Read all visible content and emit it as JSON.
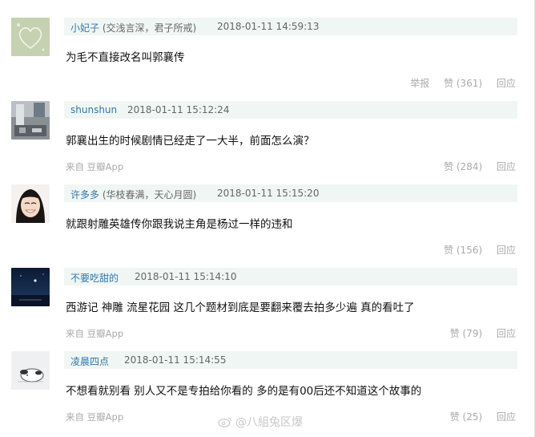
{
  "comments": [
    {
      "author": "小妃子",
      "signature": "(交浅言深，君子所戒)",
      "time": "2018-01-11 14:59:13",
      "content": "为毛不直接改名叫郭襄传",
      "source": "",
      "report": "举报",
      "like": "赞 (361)",
      "reply": "回应",
      "avatar_icon": "heart-drawing"
    },
    {
      "author": "shunshun",
      "signature": "",
      "time": "2018-01-11 15:12:24",
      "content": "郭襄出生的时候剧情已经走了一大半，前面怎么演？",
      "source": "来自 豆瓣App",
      "report": "",
      "like": "赞 (284)",
      "reply": "回应",
      "avatar_icon": "room-photo"
    },
    {
      "author": "许多多",
      "signature": "(华枝春满，天心月圆)",
      "time": "2018-01-11 15:15:20",
      "content": "就跟射雕英雄传你跟我说主角是杨过一样的违和",
      "source": "",
      "report": "",
      "like": "赞 (156)",
      "reply": "回应",
      "avatar_icon": "smiling-face-photo"
    },
    {
      "author": "不要吃甜的",
      "signature": "",
      "time": "2018-01-11 15:14:10",
      "content": "西游记 神雕 流星花园 这几个题材到底是要翻来覆去拍多少遍 真的看吐了",
      "source": "来自 豆瓣App",
      "report": "",
      "like": "赞 (79)",
      "reply": "回应",
      "avatar_icon": "night-sky-photo"
    },
    {
      "author": "凌晨四点",
      "signature": "",
      "time": "2018-01-11 15:14:55",
      "content": "不想看就别看 别人又不是专拍给你看的 多的是有00后还不知道这个故事的",
      "source": "来自 豆瓣App",
      "report": "",
      "like": "赞 (25)",
      "reply": "回应",
      "avatar_icon": "cartoon-dog-photo"
    }
  ],
  "watermark": "@八組兔区爆"
}
